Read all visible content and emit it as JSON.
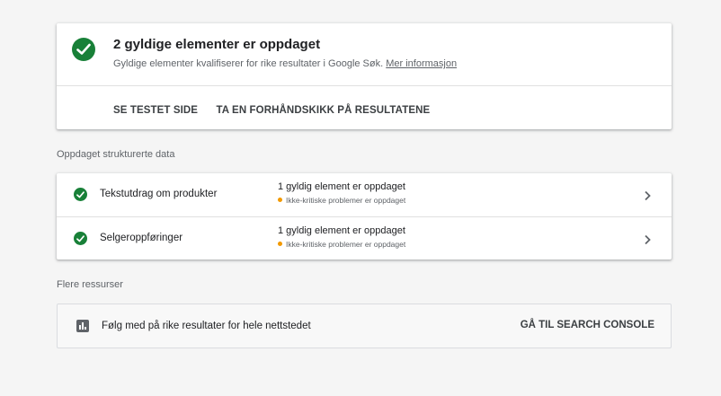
{
  "summary": {
    "title": "2 gyldige elementer er oppdaget",
    "description": "Gyldige elementer kvalifiserer for rike resultater i Google Søk.",
    "link_label": "Mer informasjon",
    "actions": [
      "SE TESTET SIDE",
      "TA EN FORHÅNDSKIKK PÅ RESULTATENE"
    ]
  },
  "structured_data": {
    "section_label": "Oppdaget strukturerte data",
    "items": [
      {
        "name": "Tekstutdrag om produkter",
        "status": "1 gyldig element er oppdaget",
        "sub_status": "Ikke-kritiske problemer er oppdaget"
      },
      {
        "name": "Selgeroppføringer",
        "status": "1 gyldig element er oppdaget",
        "sub_status": "Ikke-kritiske problemer er oppdaget"
      }
    ]
  },
  "resources": {
    "section_label": "Flere ressurser",
    "text": "Følg med på rike resultater for hele nettstedet",
    "button_label": "GÅ TIL SEARCH CONSOLE"
  },
  "colors": {
    "valid_green": "#188038",
    "warning_orange": "#f29900",
    "background": "#f5f5f5"
  },
  "icons": {
    "valid": "check-circle-icon",
    "warning": "warning-dot-icon",
    "expand": "chevron-right-icon",
    "resource": "bar-chart-icon"
  }
}
